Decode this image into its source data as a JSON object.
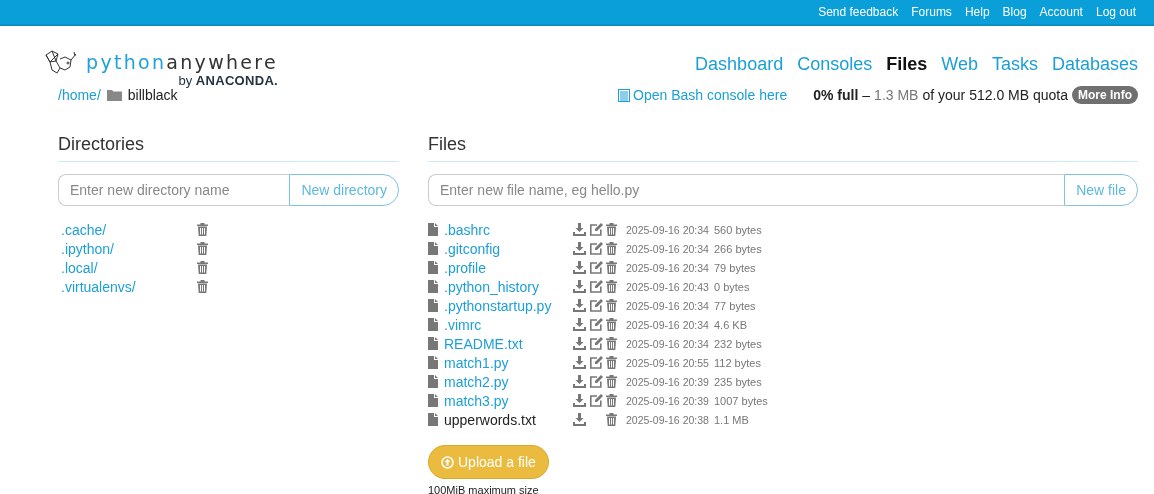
{
  "top_links": [
    "Send feedback",
    "Forums",
    "Help",
    "Blog",
    "Account",
    "Log out"
  ],
  "logo": {
    "part1": "python",
    "part2": "anywhere",
    "byline": "by",
    "company": "ANACONDA."
  },
  "nav": [
    {
      "label": "Dashboard",
      "selected": false
    },
    {
      "label": "Consoles",
      "selected": false
    },
    {
      "label": "Files",
      "selected": true
    },
    {
      "label": "Web",
      "selected": false
    },
    {
      "label": "Tasks",
      "selected": false
    },
    {
      "label": "Databases",
      "selected": false
    }
  ],
  "breadcrumb": {
    "parent": "/home/",
    "current": "billblack"
  },
  "bash_link": "Open Bash console here",
  "quota": {
    "percent": "0% full",
    "dash": "–",
    "used": "1.3 MB",
    "rest": "of your 512.0 MB quota",
    "button": "More Info"
  },
  "directories": {
    "title": "Directories",
    "placeholder": "Enter new directory name",
    "button": "New directory",
    "items": [
      ".cache/",
      ".ipython/",
      ".local/",
      ".virtualenvs/"
    ]
  },
  "files": {
    "title": "Files",
    "placeholder": "Enter new file name, eg hello.py",
    "button": "New file",
    "items": [
      {
        "name": ".bashrc",
        "editable": true,
        "modified": "2025-09-16 20:34",
        "size": "560 bytes"
      },
      {
        "name": ".gitconfig",
        "editable": true,
        "modified": "2025-09-16 20:34",
        "size": "266 bytes"
      },
      {
        "name": ".profile",
        "editable": true,
        "modified": "2025-09-16 20:34",
        "size": "79 bytes"
      },
      {
        "name": ".python_history",
        "editable": true,
        "modified": "2025-09-16 20:43",
        "size": "0 bytes"
      },
      {
        "name": ".pythonstartup.py",
        "editable": true,
        "modified": "2025-09-16 20:34",
        "size": "77 bytes"
      },
      {
        "name": ".vimrc",
        "editable": true,
        "modified": "2025-09-16 20:34",
        "size": "4.6 KB"
      },
      {
        "name": "README.txt",
        "editable": true,
        "modified": "2025-09-16 20:34",
        "size": "232 bytes"
      },
      {
        "name": "match1.py",
        "editable": true,
        "modified": "2025-09-16 20:55",
        "size": "112 bytes"
      },
      {
        "name": "match2.py",
        "editable": true,
        "modified": "2025-09-16 20:39",
        "size": "235 bytes"
      },
      {
        "name": "match3.py",
        "editable": true,
        "modified": "2025-09-16 20:39",
        "size": "1007 bytes"
      },
      {
        "name": "upperwords.txt",
        "editable": false,
        "modified": "2025-09-16 20:38",
        "size": "1.1 MB"
      }
    ],
    "upload_button": "Upload a file",
    "upload_note": "100MiB maximum size"
  }
}
